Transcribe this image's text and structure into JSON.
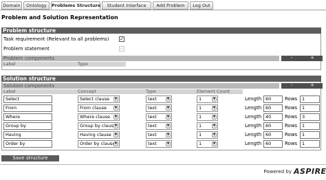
{
  "tabs": [
    "Domain",
    "Ontology",
    "Problems Structure",
    "Student Interface",
    "Add Problem",
    "Log Out"
  ],
  "active_tab": "Problems Structure",
  "page_title": "Problem and Solution Representation",
  "problem": {
    "header": "Problem structure",
    "task_requirement_label": "Task requirement (Relevant to all problems)",
    "task_requirement_checked": true,
    "problem_statement_label": "Problem statement",
    "problem_statement_checked": true,
    "components_header": "Problem components",
    "columns": [
      "Label",
      "Type"
    ],
    "minus": "-",
    "plus": "+"
  },
  "solution": {
    "header": "Solution structure",
    "components_header": "Solution components",
    "columns": [
      "Label",
      "Concept",
      "Type",
      "Element Count"
    ],
    "minus": "-",
    "plus": "+",
    "length_label": "Length",
    "rows_label": "Rows",
    "rows": [
      {
        "label": "Select",
        "concept": "Select clause",
        "type": "text",
        "count": "1",
        "length": "60",
        "rows": "1"
      },
      {
        "label": "From",
        "concept": "From clause",
        "type": "text",
        "count": "1",
        "length": "60",
        "rows": "1"
      },
      {
        "label": "Where",
        "concept": "Where clause",
        "type": "text",
        "count": "1",
        "length": "40",
        "rows": "3"
      },
      {
        "label": "Group by",
        "concept": "Group by clause",
        "type": "text",
        "count": "1",
        "length": "60",
        "rows": "1"
      },
      {
        "label": "Having",
        "concept": "Having clause",
        "type": "text",
        "count": "1",
        "length": "60",
        "rows": "1"
      },
      {
        "label": "Order by",
        "concept": "Order by clause",
        "type": "text",
        "count": "1",
        "length": "60",
        "rows": "1"
      }
    ]
  },
  "save_button": "Save structure",
  "footer": {
    "powered_by": "Powered by",
    "logo_text": "ASPIRE"
  },
  "icons": {
    "dropdown": "chevron-down-icon",
    "check": "checkmark-icon"
  }
}
